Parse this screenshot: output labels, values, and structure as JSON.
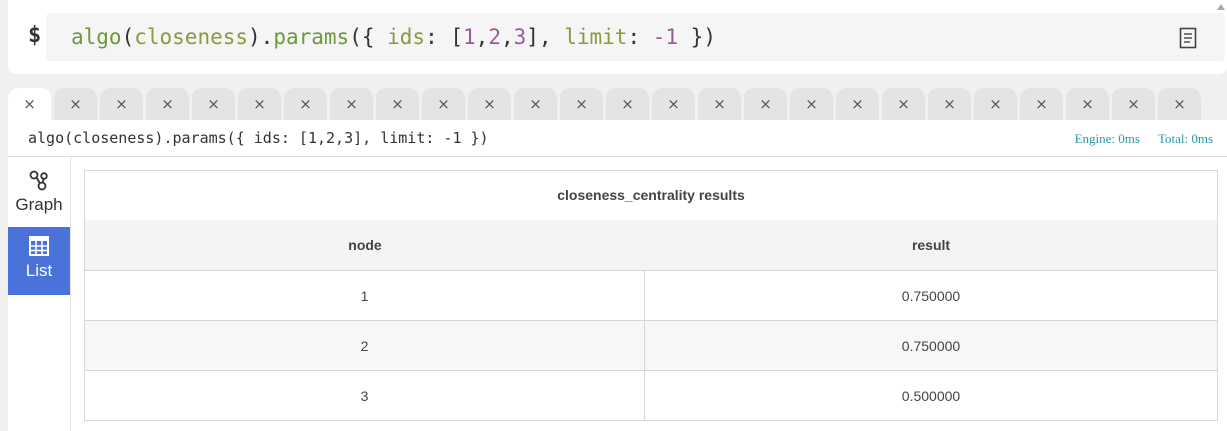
{
  "query_bar": {
    "prompt": "$",
    "code": {
      "fn": "algo",
      "p1": "(",
      "arg": "closeness",
      "p2": ").",
      "method": "params",
      "p3": "({ ",
      "key1": "ids",
      "p4": ": [",
      "n1": "1",
      "comma1": ",",
      "n2": "2",
      "comma2": ",",
      "n3": "3",
      "p5": "], ",
      "key2": "limit",
      "p6": ": ",
      "n4": "-1",
      "p7": " })"
    },
    "doc_icon": "document-icon"
  },
  "tabs": {
    "count": 26,
    "close_glyph": "×"
  },
  "result": {
    "query_text": "algo(closeness).params({ ids: [1,2,3], limit: -1 })",
    "engine_label": "Engine: 0ms",
    "total_label": "Total: 0ms"
  },
  "sidebar": {
    "graph_label": "Graph",
    "list_label": "List"
  },
  "table": {
    "title": "closeness_centrality results",
    "columns": [
      "node",
      "result"
    ],
    "rows": [
      [
        "1",
        "0.750000"
      ],
      [
        "2",
        "0.750000"
      ],
      [
        "3",
        "0.500000"
      ]
    ]
  },
  "colors": {
    "accent": "#4a72d8",
    "timing": "#2a9aa8"
  }
}
